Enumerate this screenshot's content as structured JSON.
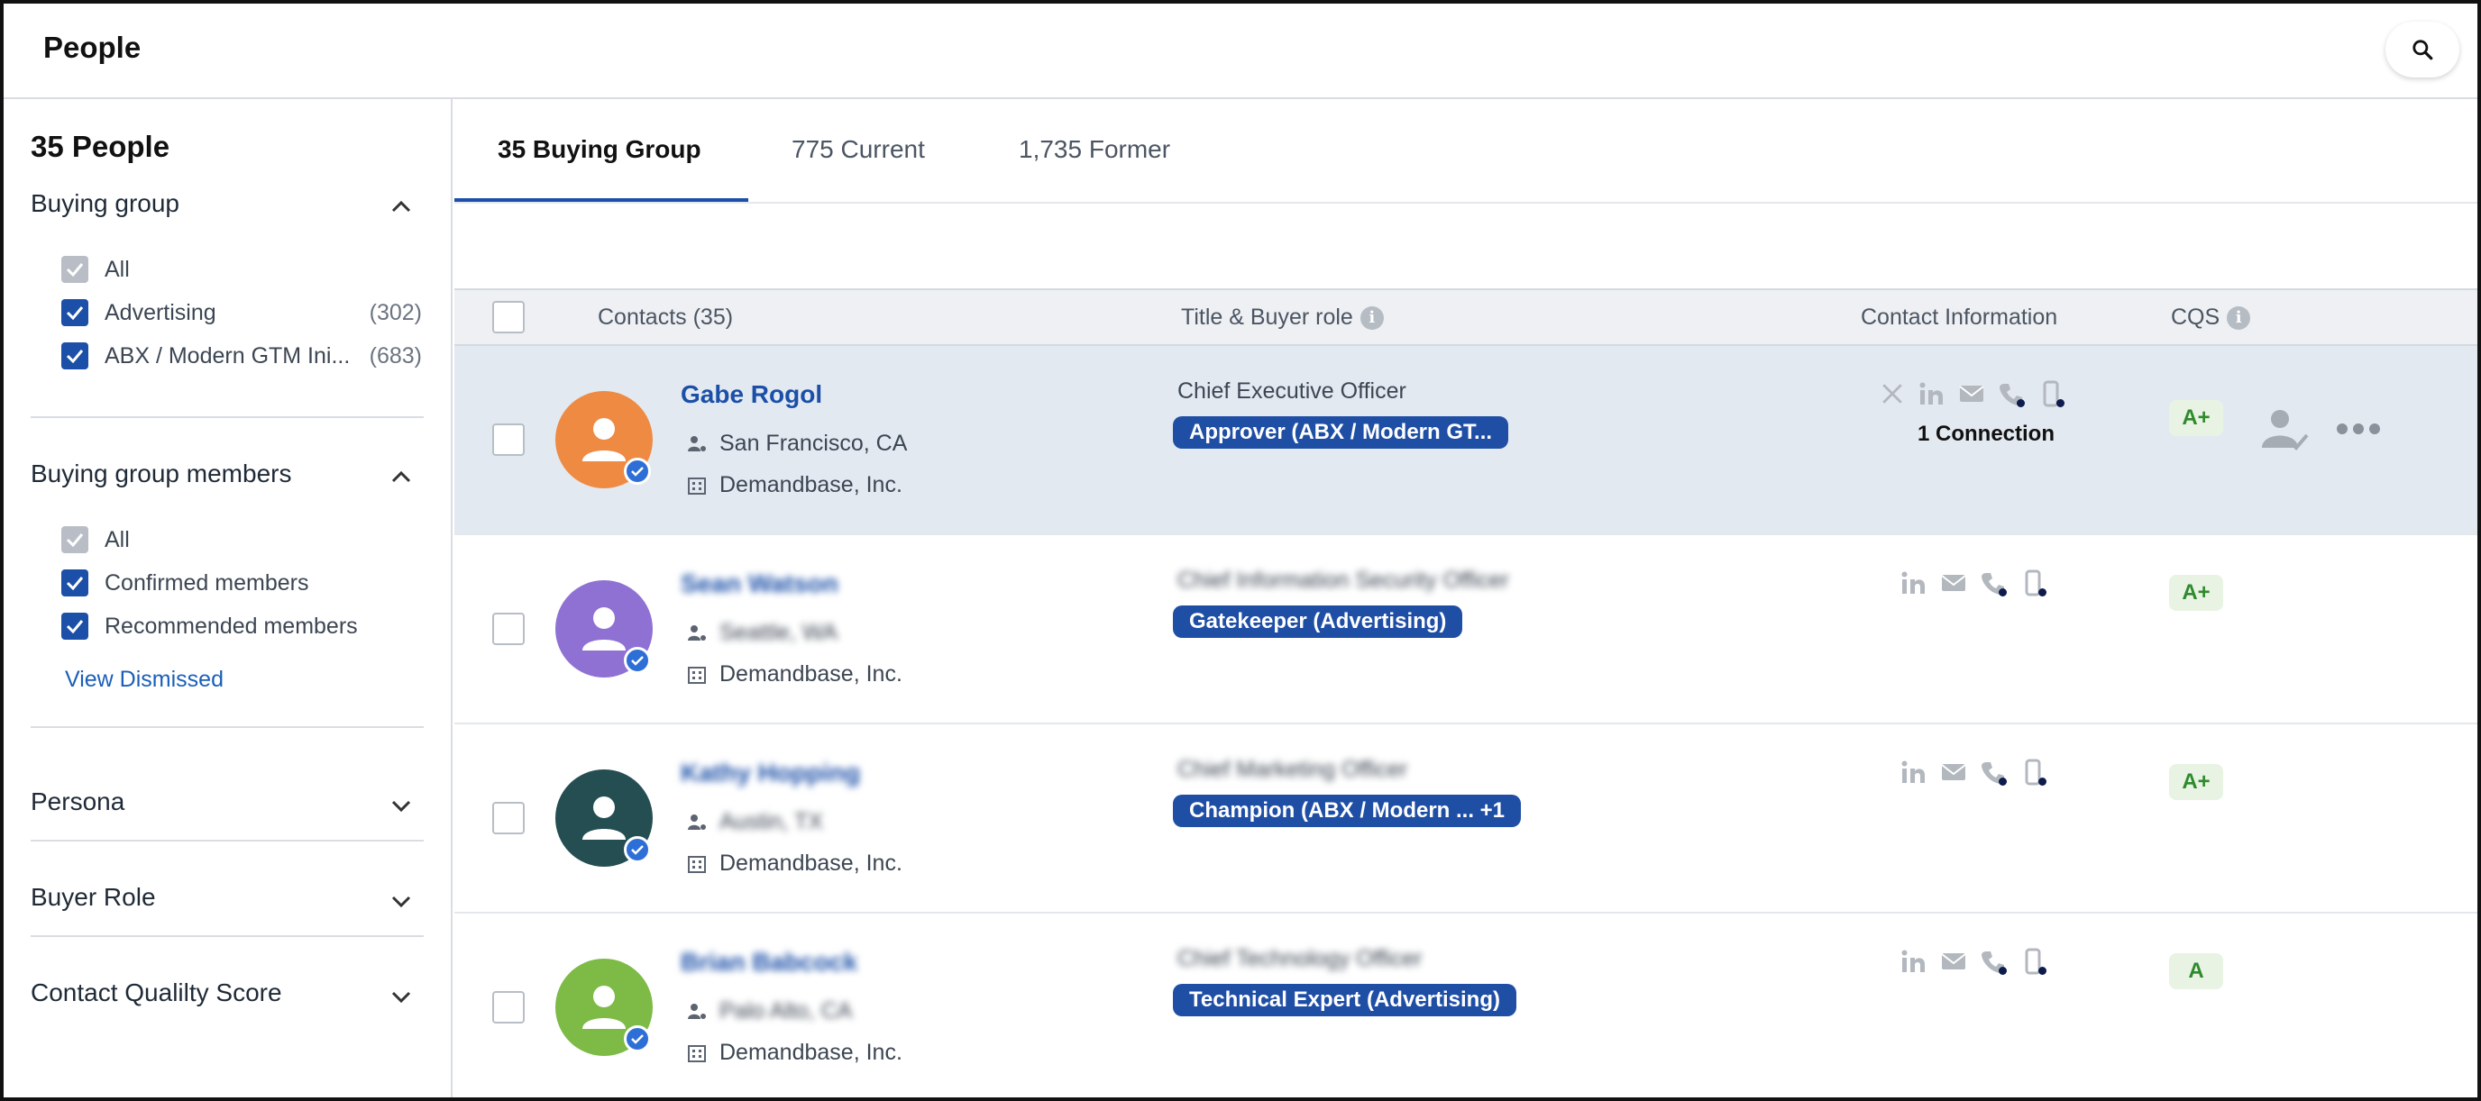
{
  "header": {
    "title": "People",
    "search_icon": "search-icon"
  },
  "sidebar": {
    "people_count": "35 People",
    "buying_group": {
      "title": "Buying group",
      "items": [
        {
          "label": "All",
          "count": "",
          "state": "indeterminate"
        },
        {
          "label": "Advertising",
          "count": "(302)",
          "state": "checked"
        },
        {
          "label": "ABX / Modern GTM Ini...",
          "count": "(683)",
          "state": "checked"
        }
      ]
    },
    "buying_group_members": {
      "title": "Buying group members",
      "items": [
        {
          "label": "All",
          "state": "indeterminate"
        },
        {
          "label": "Confirmed members",
          "state": "checked"
        },
        {
          "label": "Recommended members",
          "state": "checked"
        }
      ],
      "view_dismissed": "View Dismissed"
    },
    "collapsed_sections": [
      "Persona",
      "Buyer Role",
      "Contact Qualilty Score"
    ]
  },
  "tabs": [
    {
      "label": "35 Buying Group",
      "active": true
    },
    {
      "label": "775 Current",
      "active": false
    },
    {
      "label": "1,735 Former",
      "active": false
    }
  ],
  "table": {
    "columns": {
      "contacts": "Contacts (35)",
      "title_role": "Title & Buyer role",
      "contact_info": "Contact Information",
      "cqs": "CQS"
    },
    "rows": [
      {
        "name": "Gabe Rogol",
        "location": "San Francisco, CA",
        "company": "Demandbase, Inc.",
        "title": "Chief Executive Officer",
        "role": "Approver (ABX / Modern GT...",
        "connection": "1 Connection",
        "cqs": "A+",
        "avatar_color": "#ef8a43",
        "blurred": false,
        "selected": true
      },
      {
        "name": "Sean Watson",
        "location": "Seattle, WA",
        "company": "Demandbase, Inc.",
        "title": "Chief Information Security Officer",
        "role": "Gatekeeper (Advertising)",
        "connection": "",
        "cqs": "A+",
        "avatar_color": "#8f71d4",
        "blurred": true,
        "selected": false
      },
      {
        "name": "Kathy Hopping",
        "location": "Austin, TX",
        "company": "Demandbase, Inc.",
        "title": "Chief Marketing Officer",
        "role": "Champion (ABX / Modern ...  +1",
        "connection": "",
        "cqs": "A+",
        "avatar_color": "#244e52",
        "blurred": true,
        "selected": false
      },
      {
        "name": "Brian Babcock",
        "location": "Palo Alto, CA",
        "company": "Demandbase, Inc.",
        "title": "Chief Technology Officer",
        "role": "Technical Expert (Advertising)",
        "connection": "",
        "cqs": "A",
        "avatar_color": "#7dbb46",
        "blurred": true,
        "selected": false
      }
    ]
  },
  "colors": {
    "accent": "#1b4fa8",
    "pill": "#1f4ea5",
    "selected_row": "#e3e9f1",
    "cqs_green": "#2f8a2c"
  }
}
